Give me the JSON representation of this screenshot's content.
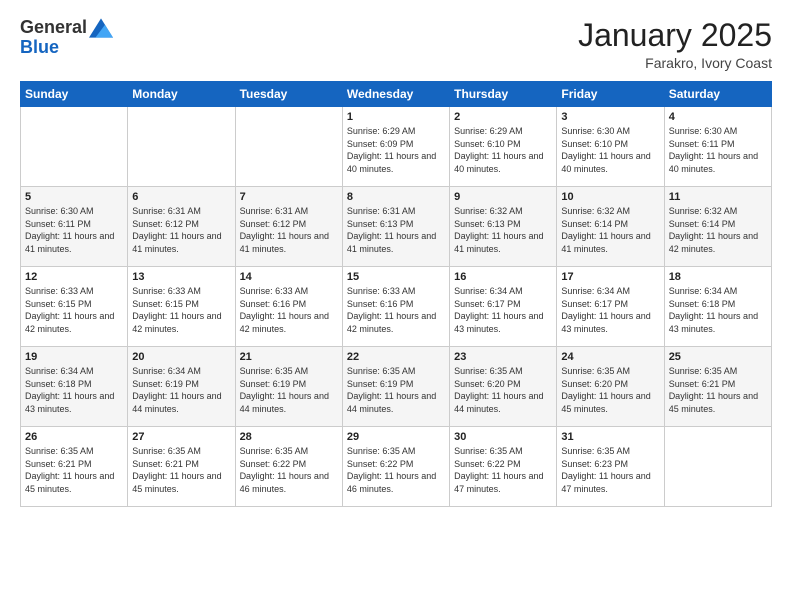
{
  "logo": {
    "general": "General",
    "blue": "Blue"
  },
  "title": "January 2025",
  "subtitle": "Farakro, Ivory Coast",
  "days_header": [
    "Sunday",
    "Monday",
    "Tuesday",
    "Wednesday",
    "Thursday",
    "Friday",
    "Saturday"
  ],
  "weeks": [
    [
      {
        "day": "",
        "sunrise": "",
        "sunset": "",
        "daylight": ""
      },
      {
        "day": "",
        "sunrise": "",
        "sunset": "",
        "daylight": ""
      },
      {
        "day": "",
        "sunrise": "",
        "sunset": "",
        "daylight": ""
      },
      {
        "day": "1",
        "sunrise": "Sunrise: 6:29 AM",
        "sunset": "Sunset: 6:09 PM",
        "daylight": "Daylight: 11 hours and 40 minutes."
      },
      {
        "day": "2",
        "sunrise": "Sunrise: 6:29 AM",
        "sunset": "Sunset: 6:10 PM",
        "daylight": "Daylight: 11 hours and 40 minutes."
      },
      {
        "day": "3",
        "sunrise": "Sunrise: 6:30 AM",
        "sunset": "Sunset: 6:10 PM",
        "daylight": "Daylight: 11 hours and 40 minutes."
      },
      {
        "day": "4",
        "sunrise": "Sunrise: 6:30 AM",
        "sunset": "Sunset: 6:11 PM",
        "daylight": "Daylight: 11 hours and 40 minutes."
      }
    ],
    [
      {
        "day": "5",
        "sunrise": "Sunrise: 6:30 AM",
        "sunset": "Sunset: 6:11 PM",
        "daylight": "Daylight: 11 hours and 41 minutes."
      },
      {
        "day": "6",
        "sunrise": "Sunrise: 6:31 AM",
        "sunset": "Sunset: 6:12 PM",
        "daylight": "Daylight: 11 hours and 41 minutes."
      },
      {
        "day": "7",
        "sunrise": "Sunrise: 6:31 AM",
        "sunset": "Sunset: 6:12 PM",
        "daylight": "Daylight: 11 hours and 41 minutes."
      },
      {
        "day": "8",
        "sunrise": "Sunrise: 6:31 AM",
        "sunset": "Sunset: 6:13 PM",
        "daylight": "Daylight: 11 hours and 41 minutes."
      },
      {
        "day": "9",
        "sunrise": "Sunrise: 6:32 AM",
        "sunset": "Sunset: 6:13 PM",
        "daylight": "Daylight: 11 hours and 41 minutes."
      },
      {
        "day": "10",
        "sunrise": "Sunrise: 6:32 AM",
        "sunset": "Sunset: 6:14 PM",
        "daylight": "Daylight: 11 hours and 41 minutes."
      },
      {
        "day": "11",
        "sunrise": "Sunrise: 6:32 AM",
        "sunset": "Sunset: 6:14 PM",
        "daylight": "Daylight: 11 hours and 42 minutes."
      }
    ],
    [
      {
        "day": "12",
        "sunrise": "Sunrise: 6:33 AM",
        "sunset": "Sunset: 6:15 PM",
        "daylight": "Daylight: 11 hours and 42 minutes."
      },
      {
        "day": "13",
        "sunrise": "Sunrise: 6:33 AM",
        "sunset": "Sunset: 6:15 PM",
        "daylight": "Daylight: 11 hours and 42 minutes."
      },
      {
        "day": "14",
        "sunrise": "Sunrise: 6:33 AM",
        "sunset": "Sunset: 6:16 PM",
        "daylight": "Daylight: 11 hours and 42 minutes."
      },
      {
        "day": "15",
        "sunrise": "Sunrise: 6:33 AM",
        "sunset": "Sunset: 6:16 PM",
        "daylight": "Daylight: 11 hours and 42 minutes."
      },
      {
        "day": "16",
        "sunrise": "Sunrise: 6:34 AM",
        "sunset": "Sunset: 6:17 PM",
        "daylight": "Daylight: 11 hours and 43 minutes."
      },
      {
        "day": "17",
        "sunrise": "Sunrise: 6:34 AM",
        "sunset": "Sunset: 6:17 PM",
        "daylight": "Daylight: 11 hours and 43 minutes."
      },
      {
        "day": "18",
        "sunrise": "Sunrise: 6:34 AM",
        "sunset": "Sunset: 6:18 PM",
        "daylight": "Daylight: 11 hours and 43 minutes."
      }
    ],
    [
      {
        "day": "19",
        "sunrise": "Sunrise: 6:34 AM",
        "sunset": "Sunset: 6:18 PM",
        "daylight": "Daylight: 11 hours and 43 minutes."
      },
      {
        "day": "20",
        "sunrise": "Sunrise: 6:34 AM",
        "sunset": "Sunset: 6:19 PM",
        "daylight": "Daylight: 11 hours and 44 minutes."
      },
      {
        "day": "21",
        "sunrise": "Sunrise: 6:35 AM",
        "sunset": "Sunset: 6:19 PM",
        "daylight": "Daylight: 11 hours and 44 minutes."
      },
      {
        "day": "22",
        "sunrise": "Sunrise: 6:35 AM",
        "sunset": "Sunset: 6:19 PM",
        "daylight": "Daylight: 11 hours and 44 minutes."
      },
      {
        "day": "23",
        "sunrise": "Sunrise: 6:35 AM",
        "sunset": "Sunset: 6:20 PM",
        "daylight": "Daylight: 11 hours and 44 minutes."
      },
      {
        "day": "24",
        "sunrise": "Sunrise: 6:35 AM",
        "sunset": "Sunset: 6:20 PM",
        "daylight": "Daylight: 11 hours and 45 minutes."
      },
      {
        "day": "25",
        "sunrise": "Sunrise: 6:35 AM",
        "sunset": "Sunset: 6:21 PM",
        "daylight": "Daylight: 11 hours and 45 minutes."
      }
    ],
    [
      {
        "day": "26",
        "sunrise": "Sunrise: 6:35 AM",
        "sunset": "Sunset: 6:21 PM",
        "daylight": "Daylight: 11 hours and 45 minutes."
      },
      {
        "day": "27",
        "sunrise": "Sunrise: 6:35 AM",
        "sunset": "Sunset: 6:21 PM",
        "daylight": "Daylight: 11 hours and 45 minutes."
      },
      {
        "day": "28",
        "sunrise": "Sunrise: 6:35 AM",
        "sunset": "Sunset: 6:22 PM",
        "daylight": "Daylight: 11 hours and 46 minutes."
      },
      {
        "day": "29",
        "sunrise": "Sunrise: 6:35 AM",
        "sunset": "Sunset: 6:22 PM",
        "daylight": "Daylight: 11 hours and 46 minutes."
      },
      {
        "day": "30",
        "sunrise": "Sunrise: 6:35 AM",
        "sunset": "Sunset: 6:22 PM",
        "daylight": "Daylight: 11 hours and 47 minutes."
      },
      {
        "day": "31",
        "sunrise": "Sunrise: 6:35 AM",
        "sunset": "Sunset: 6:23 PM",
        "daylight": "Daylight: 11 hours and 47 minutes."
      },
      {
        "day": "",
        "sunrise": "",
        "sunset": "",
        "daylight": ""
      }
    ]
  ]
}
